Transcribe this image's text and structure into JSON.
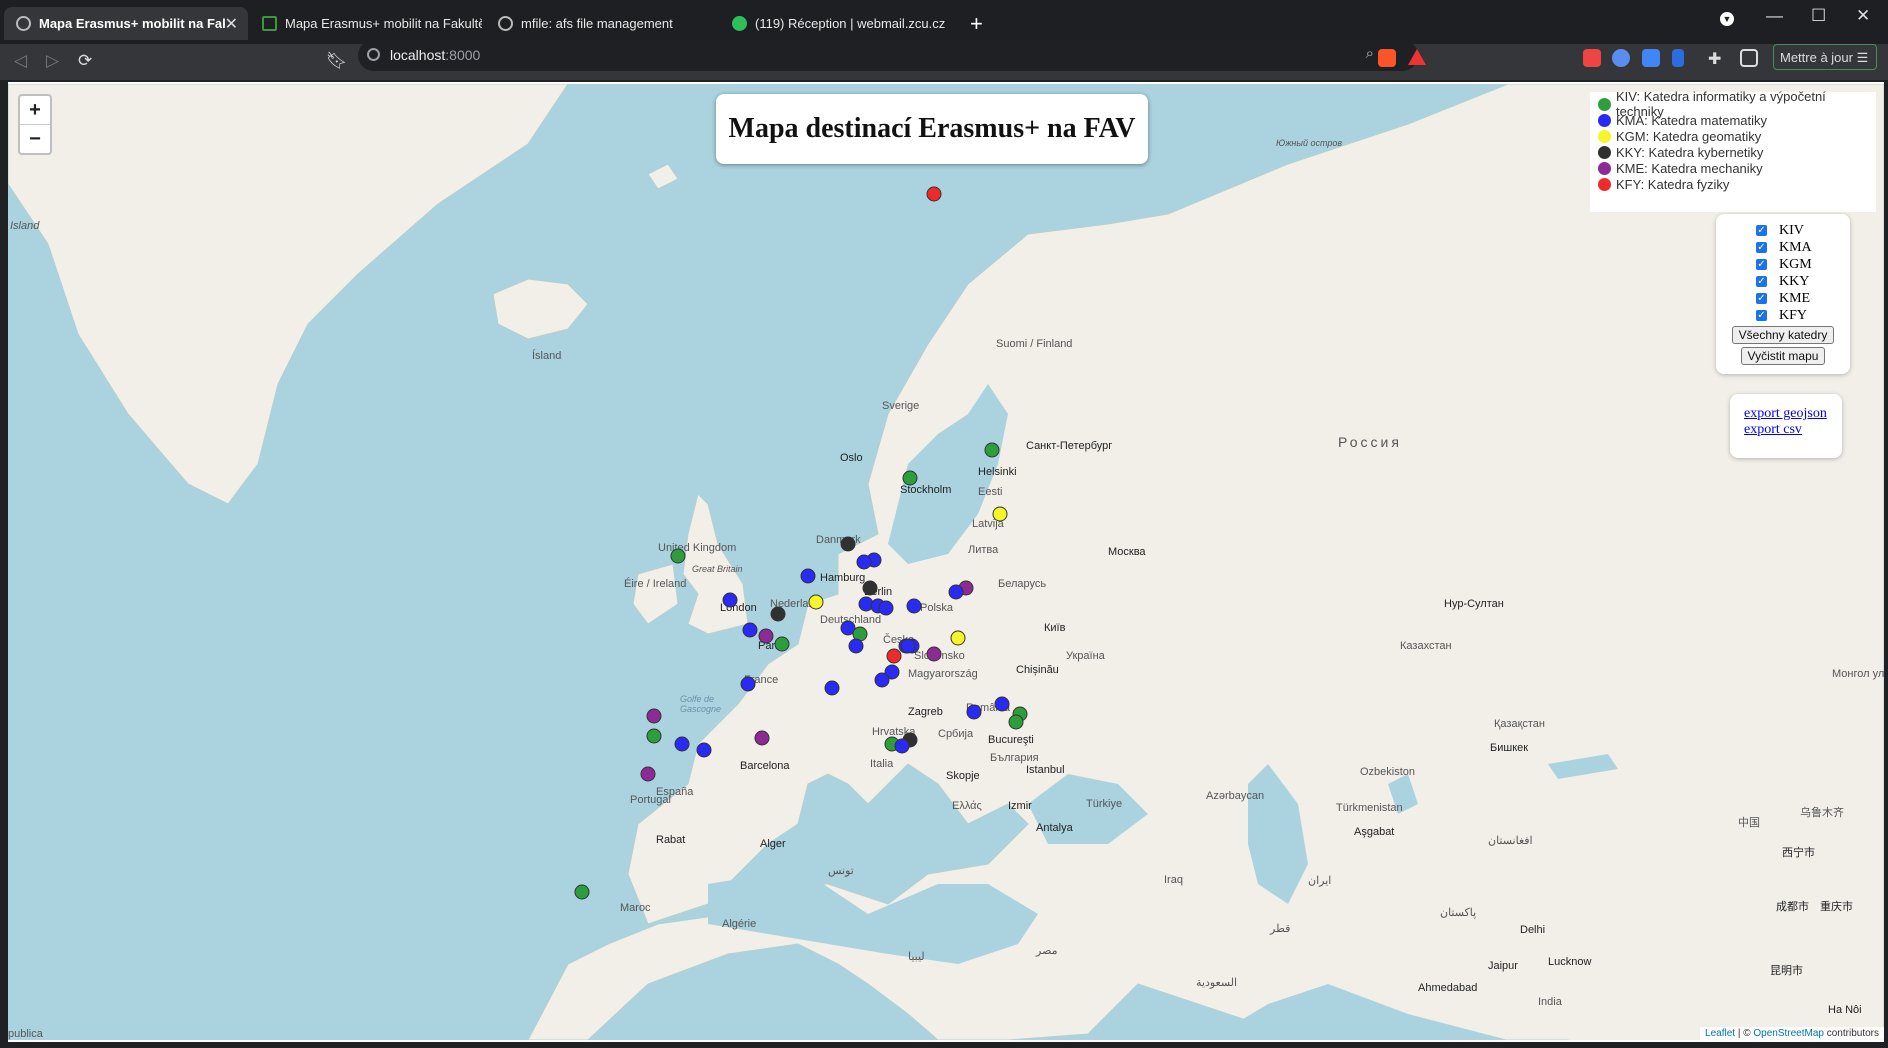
{
  "browser": {
    "tabs": [
      {
        "label": "Mapa Erasmus+ mobilit na Fakult",
        "active": true
      },
      {
        "label": "Mapa Erasmus+ mobilit na Fakultě ap",
        "active": false
      },
      {
        "label": "mfile: afs file management",
        "active": false
      },
      {
        "label": "(119) Réception | webmail.zcu.cz",
        "active": false
      }
    ],
    "url_host": "localhost",
    "url_port": ":8000",
    "update_button": "Mettre à jour ☰"
  },
  "map": {
    "title": "Mapa destinací Erasmus+ na FAV",
    "zoom_in": "+",
    "zoom_out": "−",
    "legend": [
      {
        "label": "KIV: Katedra informatiky a výpočetní techniky",
        "color": "#2e9e3c"
      },
      {
        "label": "KMA: Katedra matematiky",
        "color": "#2a2af5"
      },
      {
        "label": "KGM: Katedra geomatiky",
        "color": "#f5f52a"
      },
      {
        "label": "KKY: Katedra kybernetiky",
        "color": "#303030"
      },
      {
        "label": "KME: Katedra mechaniky",
        "color": "#8e2a95"
      },
      {
        "label": "KFY: Katedra fyziky",
        "color": "#f02a2a"
      }
    ],
    "filters": [
      {
        "label": "KIV",
        "checked": true
      },
      {
        "label": "KMA",
        "checked": true
      },
      {
        "label": "KGM",
        "checked": true
      },
      {
        "label": "KKY",
        "checked": true
      },
      {
        "label": "KME",
        "checked": true
      },
      {
        "label": "KFY",
        "checked": true
      }
    ],
    "all_departments_button": "Všechny katedry",
    "clear_map_button": "Vyčistit mapu",
    "export_geojson": "export geojson",
    "export_csv": "export csv",
    "attribution_leaflet": "Leaflet",
    "attribution_sep": " | © ",
    "attribution_osm": "OpenStreetMap",
    "attribution_suffix": " contributors",
    "place_labels": [
      "Island",
      "Ísland",
      "Suomi / Finland",
      "Sverige",
      "Oslo",
      "Helsinki",
      "Санкт-Петербург",
      "Stockholm",
      "Eesti",
      "Latvija",
      "Danmark",
      "United Kingdom",
      "Great Britain",
      "Éire / Ireland",
      "Hamburg",
      "Berlin",
      "Nederland",
      "London",
      "Polska",
      "Deutschland",
      "Paris",
      "Česko",
      "France",
      "Slovensko",
      "Magyarország",
      "Беларусь",
      "Україна",
      "Київ",
      "Chișinău",
      "Zagreb",
      "Hrvatska",
      "Србија",
      "România",
      "Italia",
      "Barcelona",
      "España",
      "Portugal",
      "Bucureşti",
      "България",
      "Istanbul",
      "Skopje",
      "Ελλάς",
      "Türkiye",
      "Izmir",
      "Antalya",
      "Москва",
      "Литва",
      "Rabat",
      "Alger",
      "Maroc",
      "Algérie",
      "Россия",
      "Казахстан",
      "Нур-Султан",
      "Бишкек",
      "Қазақстан",
      "Ozbekiston",
      "Türkmenistan",
      "Aşgabat",
      "Azərbaycan",
      "Южный остров",
      "Монгол улс",
      "乌鲁木齐",
      "中国",
      "India",
      "Delhi",
      "Lucknow",
      "Jaipur",
      "Ahmedabad",
      "西宁市",
      "成都市",
      "重庆市",
      "昆明市",
      "Ha Nôi",
      "Iraq",
      "ایران",
      "پاکستان",
      "مصر",
      "السعودية",
      "ليبيا",
      "تونس",
      "افغانستان",
      "قطر",
      "Golfe de Gascogne",
      "publica"
    ]
  }
}
